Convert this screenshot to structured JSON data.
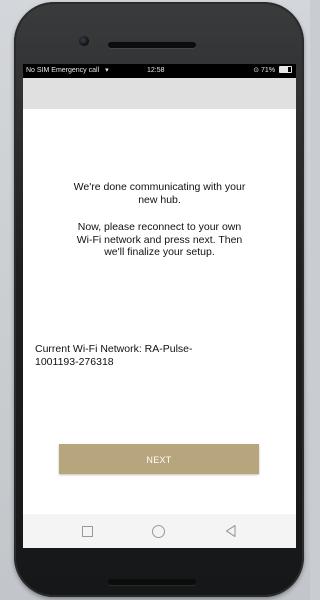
{
  "status_bar": {
    "left_text": "No SIM  Emergency call",
    "wifi_icon": "wifi-icon",
    "time": "12:58",
    "battery_percent": "71%",
    "battery_level": 0.71,
    "right_icon": "data-sync-icon"
  },
  "content": {
    "message_done": "We're done communicating with your new hub.",
    "message_reconnect": "Now, please reconnect to your own Wi-Fi network and press next. Then we'll finalize your setup.",
    "current_network": "Current Wi-Fi Network: RA-Pulse-1001193-276318"
  },
  "actions": {
    "next_label": "NEXT"
  },
  "nav_bar": {
    "recents_icon": "square-icon",
    "home_icon": "circle-icon",
    "back_icon": "triangle-back-icon"
  },
  "colors": {
    "accent": "#b7a57e",
    "appbar": "#e0e0e0",
    "statusbar": "#000000"
  }
}
